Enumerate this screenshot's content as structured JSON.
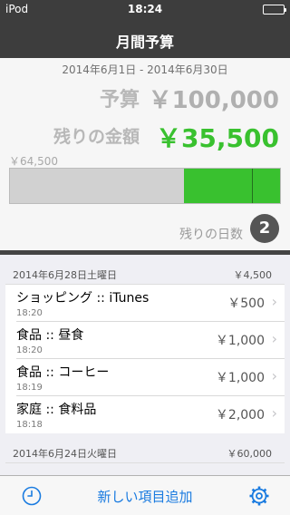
{
  "status": {
    "carrier": "iPod",
    "time": "18:24"
  },
  "nav": {
    "title": "月間予算"
  },
  "summary": {
    "date_range": "2014年6月1日 - 2014年6月30日",
    "budget_label": "予算",
    "budget_value": "￥100,000",
    "remaining_label": "残りの金額",
    "remaining_value": "￥35,500",
    "spent_label": "￥64,500",
    "remaining_fraction": 0.355,
    "days_label": "残りの日数",
    "days_value": "2",
    "colors": {
      "remaining": "#39c12f",
      "spent": "#d1d1d1"
    }
  },
  "sections": [
    {
      "date": "2014年6月28日土曜日",
      "total": "￥4,500",
      "items": [
        {
          "title": "ショッピング :: iTunes",
          "time": "18:20",
          "amount": "￥500"
        },
        {
          "title": "食品 :: 昼食",
          "time": "18:20",
          "amount": "￥1,000"
        },
        {
          "title": "食品 :: コーヒー",
          "time": "18:19",
          "amount": "￥1,000"
        },
        {
          "title": "家庭 :: 食料品",
          "time": "18:18",
          "amount": "￥2,000"
        }
      ]
    },
    {
      "date": "2014年6月24日火曜日",
      "total": "￥60,000",
      "items": []
    }
  ],
  "toolbar": {
    "history_icon": "clock-icon",
    "add_label": "新しい項目追加",
    "settings_icon": "gear-icon",
    "accent": "#1a7be0"
  }
}
